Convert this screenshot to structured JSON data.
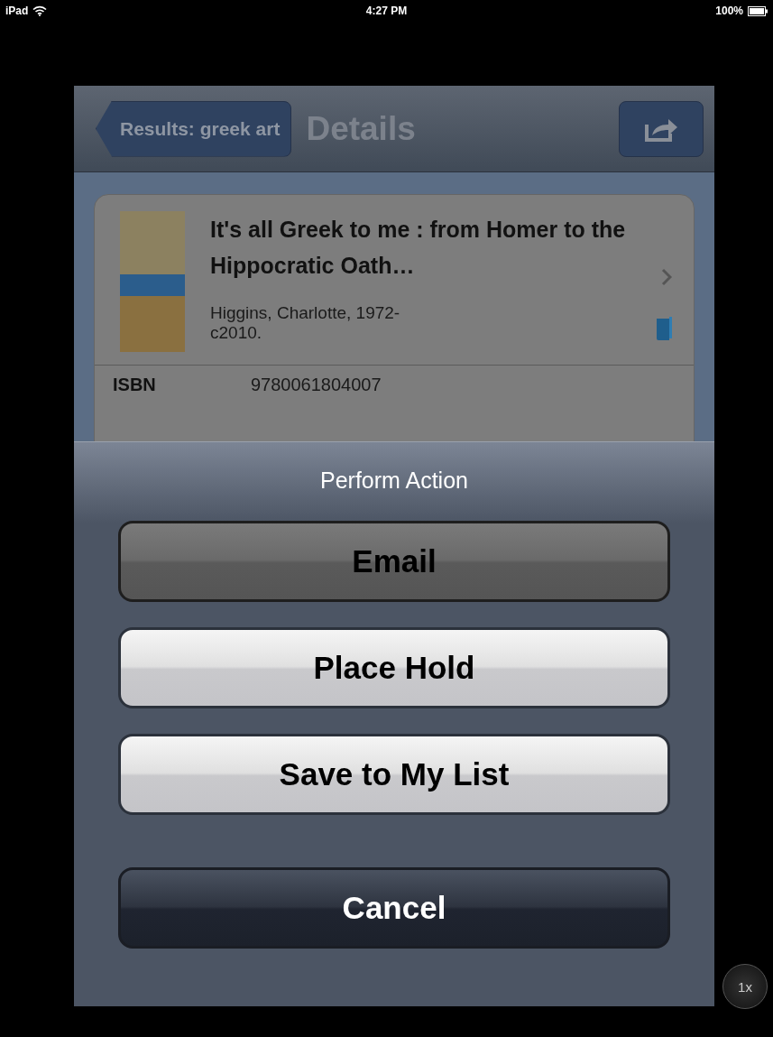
{
  "status_bar": {
    "device": "iPad",
    "time": "4:27 PM",
    "battery": "100%"
  },
  "nav_bar": {
    "back_button": "Results: greek art",
    "title": "Details"
  },
  "record": {
    "title": "It's all Greek to me : from Homer to the Hippocratic Oath…",
    "author": "Higgins, Charlotte, 1972-",
    "date": "c2010.",
    "fields": [
      {
        "label": "ISBN",
        "value": "9780061804007"
      }
    ]
  },
  "action_sheet": {
    "title": "Perform Action",
    "buttons": [
      {
        "label": "Email",
        "kind": "action",
        "pressed": true
      },
      {
        "label": "Place Hold",
        "kind": "action",
        "pressed": false
      },
      {
        "label": "Save to My List",
        "kind": "action",
        "pressed": false
      },
      {
        "label": "Cancel",
        "kind": "cancel",
        "pressed": false
      }
    ]
  },
  "zoom_badge": "1x"
}
